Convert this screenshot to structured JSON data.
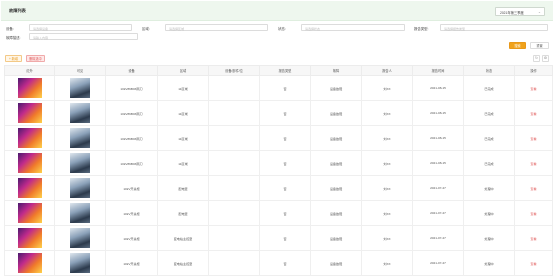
{
  "header": {
    "title": "故障列表",
    "quarter_select": "2021年第三季度",
    "chevron_icon": "chevron-down-icon"
  },
  "filters": {
    "device_label": "设备:",
    "device_placeholder": "请选择设备",
    "area_label": "区域:",
    "area_placeholder": "请选择区域",
    "status_label": "状态:",
    "status_placeholder": "请选择状态",
    "fault_type_label": "报告类型:",
    "fault_type_placeholder": "请选择报告类型",
    "fault_desc_label": "故障描述:",
    "fault_desc_placeholder": "请输入内容"
  },
  "toolbar": {
    "search_label": "搜索",
    "reset_label": "重置",
    "add_label": "+ 新增",
    "delete_label": "删除选中",
    "refresh_icon": "refresh-icon",
    "settings_icon": "settings-icon"
  },
  "table": {
    "columns": [
      "红外",
      "可见",
      "设备",
      "区域",
      "设备/部件/位",
      "报告类型",
      "故障",
      "报告人",
      "报告时间",
      "状态",
      "操作"
    ],
    "rows": [
      {
        "device": "10kV86B03隔刀",
        "area": "11区域",
        "part": "",
        "type": "否",
        "fault": "设备故障",
        "reporter": "刘XX",
        "time": "2021-08-15",
        "status": "已完成",
        "op": "查看"
      },
      {
        "device": "10kV86B03隔刀",
        "area": "11区域",
        "part": "",
        "type": "否",
        "fault": "设备故障",
        "reporter": "刘XX",
        "time": "2021-08-15",
        "status": "已完成",
        "op": "查看"
      },
      {
        "device": "10kV86B03隔刀",
        "area": "11区域",
        "part": "",
        "type": "否",
        "fault": "设备故障",
        "reporter": "刘XX",
        "time": "2021-08-15",
        "status": "已完成",
        "op": "查看"
      },
      {
        "device": "10kV86B03隔刀",
        "area": "11区域",
        "part": "",
        "type": "否",
        "fault": "设备故障",
        "reporter": "刘XX",
        "time": "2021-08-15",
        "status": "已完成",
        "op": "查看"
      },
      {
        "device": "10kV开关柜",
        "area": "配电室",
        "part": "",
        "type": "否",
        "fault": "设备故障",
        "reporter": "刘XX",
        "time": "2021-07-27",
        "status": "处理中",
        "op": "查看"
      },
      {
        "device": "10kV开关柜",
        "area": "配电室",
        "part": "",
        "type": "否",
        "fault": "设备故障",
        "reporter": "刘XX",
        "time": "2021-07-27",
        "status": "处理中",
        "op": "查看"
      },
      {
        "device": "10kV开关柜",
        "area": "变电站主控室",
        "part": "",
        "type": "否",
        "fault": "设备故障",
        "reporter": "刘XX",
        "time": "2021-07-27",
        "status": "处理中",
        "op": "查看"
      },
      {
        "device": "10kV开关柜",
        "area": "变电站主控室",
        "part": "",
        "type": "否",
        "fault": "设备故障",
        "reporter": "刘XX",
        "time": "2021-07-27",
        "status": "处理中",
        "op": "查看"
      }
    ]
  }
}
